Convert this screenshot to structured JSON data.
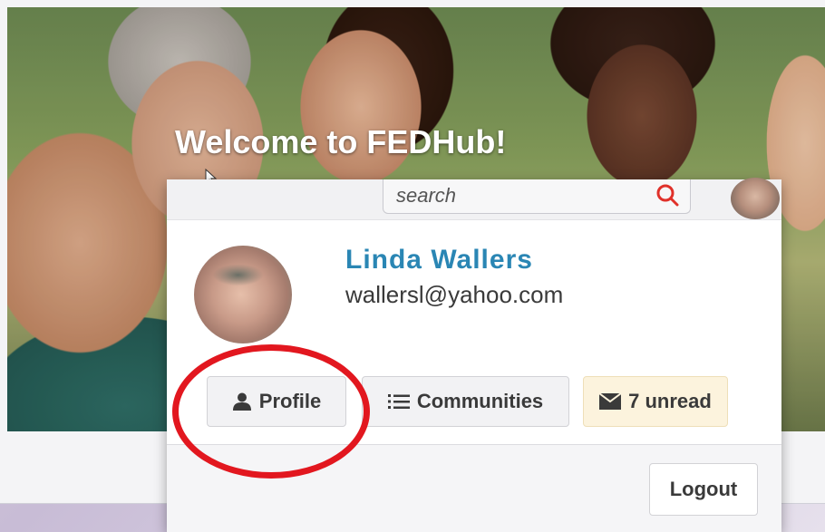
{
  "hero": {
    "title": "Welcome to FEDHub!"
  },
  "search": {
    "placeholder": "search"
  },
  "user": {
    "name": "Linda Wallers",
    "email": "wallersl@yahoo.com"
  },
  "actions": {
    "profile_label": "Profile",
    "communities_label": "Communities",
    "unread_label": "7 unread",
    "logout_label": "Logout"
  },
  "colors": {
    "name_blue": "#2a86b4",
    "search_icon_red": "#e0312a",
    "highlight_red": "#e2171f",
    "unread_bg": "#fcf3dd"
  },
  "icons": {
    "profile": "user-icon",
    "communities": "list-icon",
    "unread": "envelope-icon",
    "search": "search-icon"
  }
}
